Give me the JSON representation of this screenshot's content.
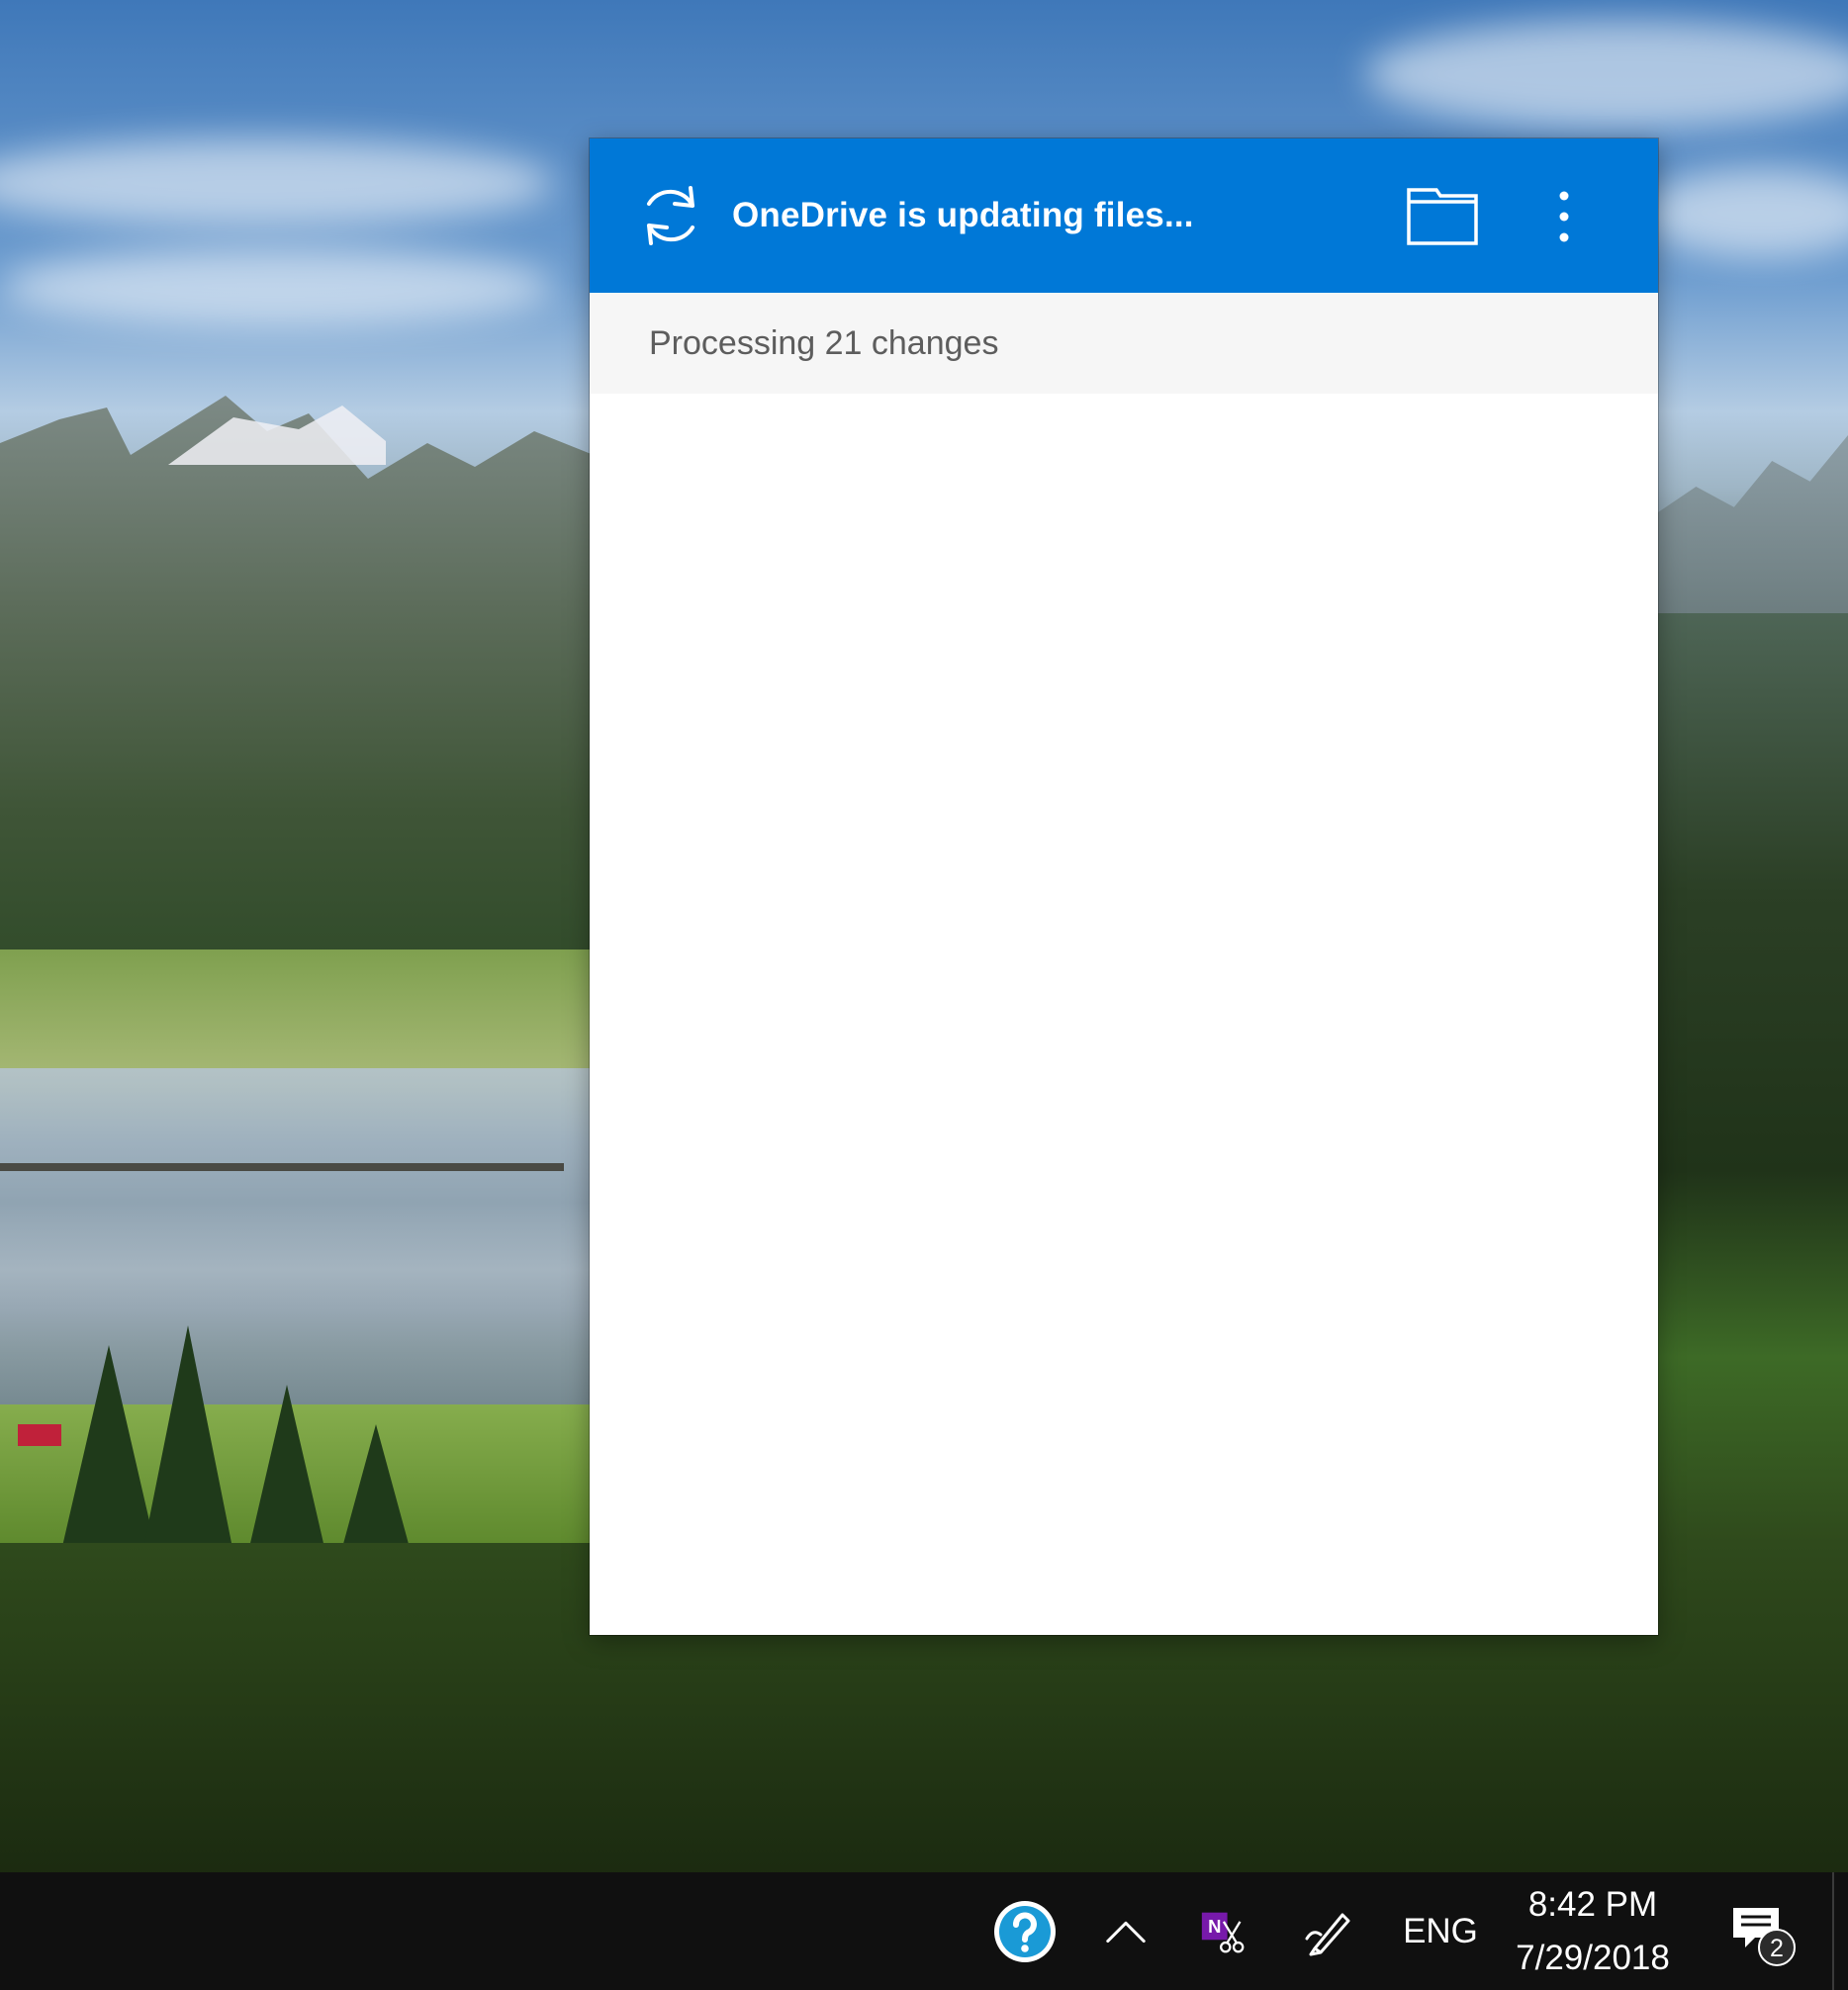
{
  "flyout": {
    "header_title": "OneDrive is updating files...",
    "status_text": "Processing 21 changes",
    "icons": {
      "sync": "sync-arrows-icon",
      "folder": "folder-icon",
      "more": "more-vertical-icon"
    },
    "colors": {
      "header_bg": "#0078d7",
      "status_bg": "#f6f6f6",
      "status_text": "#5d5d5d"
    }
  },
  "taskbar": {
    "language": "ENG",
    "time": "8:42 PM",
    "date": "7/29/2018",
    "notification_count": "2",
    "icons": {
      "help": "help-question-icon",
      "hidden_icons": "chevron-up-icon",
      "onenote": "onenote-clipper-icon",
      "pen": "pen-workspace-icon",
      "action_center": "action-center-icon"
    },
    "colors": {
      "background": "#101010",
      "help_blue": "#1a9ad6",
      "onenote_purple": "#7719aa"
    }
  }
}
